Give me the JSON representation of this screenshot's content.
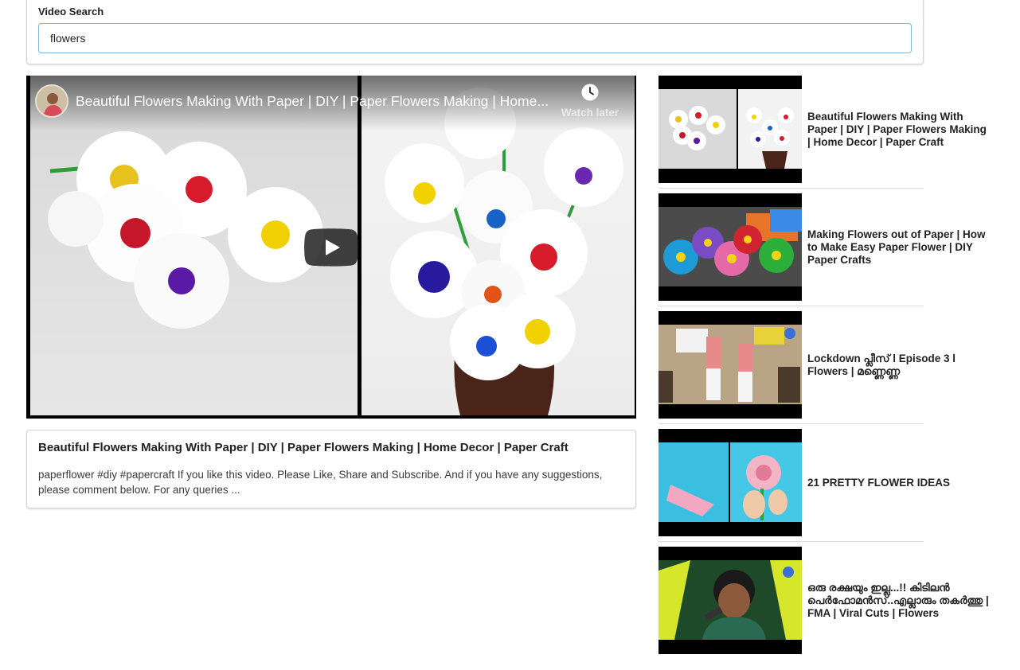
{
  "search": {
    "label": "Video Search",
    "value": "flowers"
  },
  "player": {
    "title": "Beautiful Flowers Making With Paper | DIY | Paper Flowers Making | Home...",
    "watch_later_label": "Watch later",
    "play_icon": "play-icon",
    "clock_icon": "clock-icon"
  },
  "details": {
    "title": "Beautiful Flowers Making With Paper | DIY | Paper Flowers Making | Home Decor | Paper Craft",
    "description": "paperflower #diy #papercraft If you like this video. Please Like, Share and Subscribe. And if you have any suggestions, please comment below. For any queries ..."
  },
  "video_list": [
    {
      "title": "Beautiful Flowers Making With Paper | DIY | Paper Flowers Making | Home Decor | Paper Craft"
    },
    {
      "title": "Making Flowers out of Paper | How to Make Easy Paper Flower | DIY Paper Crafts"
    },
    {
      "title": "Lockdown പ്ലീസ് l Episode 3 l Flowers | മണ്ണെണ്ണ"
    },
    {
      "title": "21 PRETTY FLOWER IDEAS"
    },
    {
      "title": "ഒരു രക്ഷയും ഇല്ല...!! കിടിലൻ പെർഫോമൻസ്..എല്ലാരും തകർത്തു | FMA | Viral Cuts | Flowers"
    }
  ],
  "colors": {
    "input_border": "#85b7d9",
    "segment_border": "#d4d4d5"
  }
}
